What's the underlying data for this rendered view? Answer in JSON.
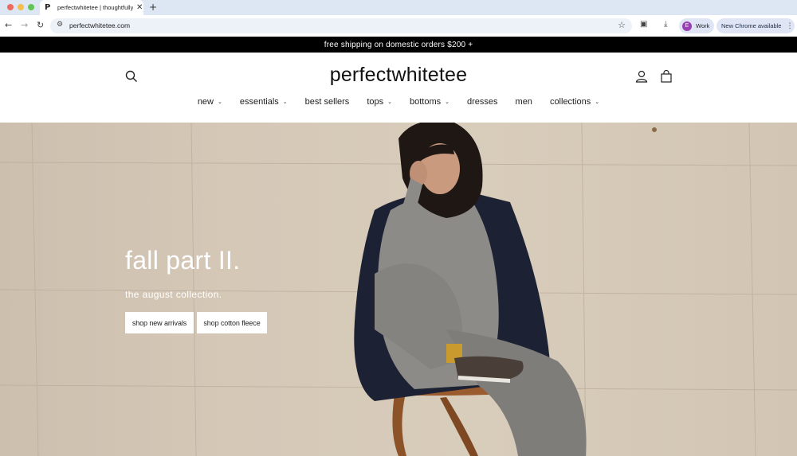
{
  "browser": {
    "tab_title": "perfectwhitetee | thoughtfully",
    "tab_favicon": "P",
    "url": "perfectwhitetee.com",
    "profile_initial": "E",
    "profile_label": "Work",
    "update_label": "New Chrome available"
  },
  "announcement": "free shipping on domestic orders $200 +",
  "header": {
    "logo": "perfectwhitetee",
    "menu": [
      {
        "label": "new",
        "has_dropdown": true
      },
      {
        "label": "essentials",
        "has_dropdown": true
      },
      {
        "label": "best sellers",
        "has_dropdown": false
      },
      {
        "label": "tops",
        "has_dropdown": true
      },
      {
        "label": "bottoms",
        "has_dropdown": true
      },
      {
        "label": "dresses",
        "has_dropdown": false
      },
      {
        "label": "men",
        "has_dropdown": false
      },
      {
        "label": "collections",
        "has_dropdown": true
      }
    ]
  },
  "hero": {
    "heading": "fall part II.",
    "subheading": "the august collection.",
    "buttons": [
      {
        "label": "shop new arrivals"
      },
      {
        "label": "shop cotton fleece"
      }
    ]
  },
  "colors": {
    "announcement_bg": "#000000",
    "tabstrip_bg": "#dde6f3",
    "avatar_bg": "#9b3fb5"
  }
}
